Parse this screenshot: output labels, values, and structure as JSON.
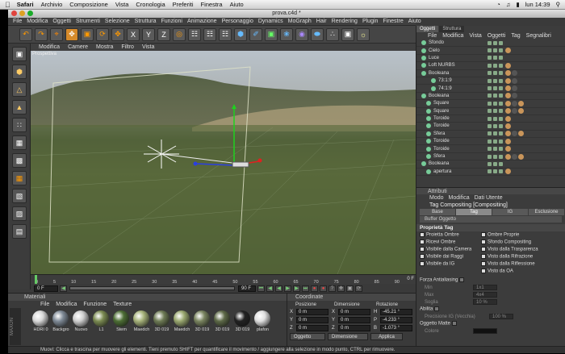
{
  "mac_menu": {
    "apple": "",
    "items": [
      "Safari",
      "Archivio",
      "Composizione",
      "Vista",
      "Cronologia",
      "Preferiti",
      "Finestra",
      "Aiuto"
    ],
    "time": "lun 14:39"
  },
  "window": {
    "title": "prova.c4d *"
  },
  "main_menu": [
    "File",
    "Modifica",
    "Oggetti",
    "Strumenti",
    "Selezione",
    "Struttura",
    "Funzioni",
    "Animazione",
    "Personaggio",
    "Dynamics",
    "MoGraph",
    "Hair",
    "Rendering",
    "Plugin",
    "Finestre",
    "Aiuto"
  ],
  "viewport": {
    "menu": [
      "Modifica",
      "Camere",
      "Mostra",
      "Filtro",
      "Vista"
    ],
    "label": "Prospettiva"
  },
  "timeline": {
    "ticks": [
      "0",
      "5",
      "10",
      "15",
      "20",
      "25",
      "30",
      "35",
      "40",
      "45",
      "50",
      "55",
      "60",
      "65",
      "70",
      "75",
      "80",
      "85",
      "90"
    ],
    "current_frame": "0 F",
    "start_frame": "0 F",
    "end_frame": "90 F",
    "frame_readout": "0 F"
  },
  "materials": {
    "title": "Materiali",
    "menu": [
      "File",
      "Modifica",
      "Funzione",
      "Texture"
    ],
    "items": [
      {
        "label": "HDRI 0",
        "color": "#d9d9d9"
      },
      {
        "label": "Backgro",
        "color": "#7f8a96"
      },
      {
        "label": "Nuovo",
        "color": "#cfcfcf"
      },
      {
        "label": "L1",
        "color": "#7b8b52"
      },
      {
        "label": "Stem",
        "color": "#4d6e35"
      },
      {
        "label": "Maedch",
        "color": "#a6b27a"
      },
      {
        "label": "3D 019",
        "color": "#6e7b55"
      },
      {
        "label": "Maedch",
        "color": "#9aa870"
      },
      {
        "label": "3D 019",
        "color": "#7a8560"
      },
      {
        "label": "3D 019",
        "color": "#5e6a48"
      },
      {
        "label": "3D 019",
        "color": "#222222"
      },
      {
        "label": "plafon",
        "color": "#e0e0e0"
      }
    ]
  },
  "coordinates": {
    "title": "Coordinate",
    "headers": [
      "Posizione",
      "Dimensione",
      "Rotazione"
    ],
    "rows": [
      {
        "axis": "X",
        "pos": "0 m",
        "dim": "0 m",
        "rot_axis": "H",
        "rot": "-45.21 °"
      },
      {
        "axis": "Y",
        "pos": "0 m",
        "dim": "0 m",
        "rot_axis": "P",
        "rot": "-4.233 °"
      },
      {
        "axis": "Z",
        "pos": "0 m",
        "dim": "0 m",
        "rot_axis": "B",
        "rot": "-1.073 °"
      }
    ],
    "mode": "Oggetto",
    "size_mode": "Dimensione",
    "apply": "Applica"
  },
  "status": "Muovi: Clicca e trascina per muovere gli elementi. Tieni premuto SHIFT per quantificare il movimento / aggiungere alla selezione in modo punto, CTRL per rimuovere.",
  "objects_panel": {
    "tabs": [
      "Oggetti",
      "Struttura"
    ],
    "menu": [
      "File",
      "Modifica",
      "Vista",
      "Oggetti",
      "Tag",
      "Segnalibri"
    ],
    "rows": [
      {
        "name": "Sfondo",
        "indent": 0,
        "tags": 0
      },
      {
        "name": "Cielo",
        "indent": 0,
        "tags": 1
      },
      {
        "name": "Luce",
        "indent": 0,
        "tags": 0
      },
      {
        "name": "Loft NURBS",
        "indent": 0,
        "tags": 1
      },
      {
        "name": "Booleana",
        "indent": 0,
        "tags": 2
      },
      {
        "name": "73:1:9",
        "indent": 2,
        "tags": 2
      },
      {
        "name": "74:1:9",
        "indent": 2,
        "tags": 2
      },
      {
        "name": "Booleana",
        "indent": 0,
        "tags": 2
      },
      {
        "name": "Square",
        "indent": 1,
        "tags": 3
      },
      {
        "name": "Square",
        "indent": 1,
        "tags": 3
      },
      {
        "name": "Toroide",
        "indent": 1,
        "tags": 1
      },
      {
        "name": "Toroide",
        "indent": 1,
        "tags": 1
      },
      {
        "name": "Sfera",
        "indent": 1,
        "tags": 3
      },
      {
        "name": "Toroide",
        "indent": 1,
        "tags": 1
      },
      {
        "name": "Toroide",
        "indent": 1,
        "tags": 1
      },
      {
        "name": "Sfera",
        "indent": 1,
        "tags": 3
      },
      {
        "name": "Booleana",
        "indent": 0,
        "tags": 0
      },
      {
        "name": "apertura",
        "indent": 1,
        "tags": 1
      }
    ]
  },
  "attributes_panel": {
    "title": "Attributi",
    "menu": [
      "Modo",
      "Modifica",
      "Dati Utente"
    ],
    "tag_title": "Tag Compositing [Compositing]",
    "tabs": [
      "Base",
      "Tag",
      "IG",
      "Esclusione"
    ],
    "buffer": "Buffer Oggetto",
    "section": "Proprietà Tag",
    "props": [
      [
        "Proietta Ombre",
        "Ombre Proprie"
      ],
      [
        "Ricevi Ombre",
        "Sfondo Compositing"
      ],
      [
        "Visibile dalla Camera",
        "Visto dalla Trasparenza"
      ],
      [
        "Visibile dai Raggi",
        "Visto dalla Rifrazione"
      ],
      [
        "Visibile da IG",
        "Visto dalla Riflessione"
      ],
      [
        "",
        "Visto da OA"
      ]
    ],
    "antialias": {
      "label": "Forza Antialiasing",
      "min_label": "Min",
      "min_value": "1x1",
      "max_label": "Max",
      "max_value": "4x4",
      "soglia_label": "Soglia",
      "soglia_value": "10 %"
    },
    "abilita": {
      "label": "Abilita",
      "prec_label": "Precisione IG (Vecchia)",
      "prec_value": "100 %"
    },
    "matte": {
      "label": "Oggetto Matte",
      "colore_label": "Colore"
    }
  }
}
